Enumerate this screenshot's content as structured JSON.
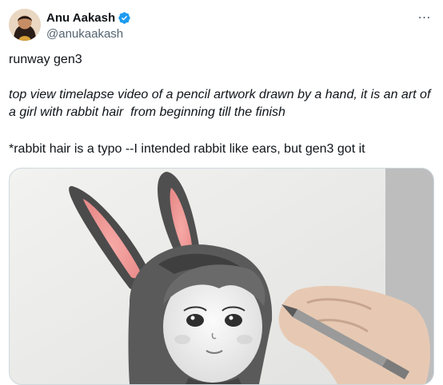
{
  "user": {
    "display_name": "Anu Aakash",
    "handle": "@anukaakash",
    "verified": true,
    "verified_color": "#1d9bf0"
  },
  "more_icon": "⋯",
  "tweet": {
    "line1": "runway gen3",
    "prompt": "top view timelapse video of a pencil artwork drawn by a hand, it is an art of a girl with rabbit hair  from beginning till the finish",
    "note": "*rabbit hair is a typo --I intended rabbit like ears, but gen3 got it"
  },
  "media": {
    "type": "video",
    "subject": "pencil drawing of a girl with rabbit ears being drawn by a hand"
  }
}
